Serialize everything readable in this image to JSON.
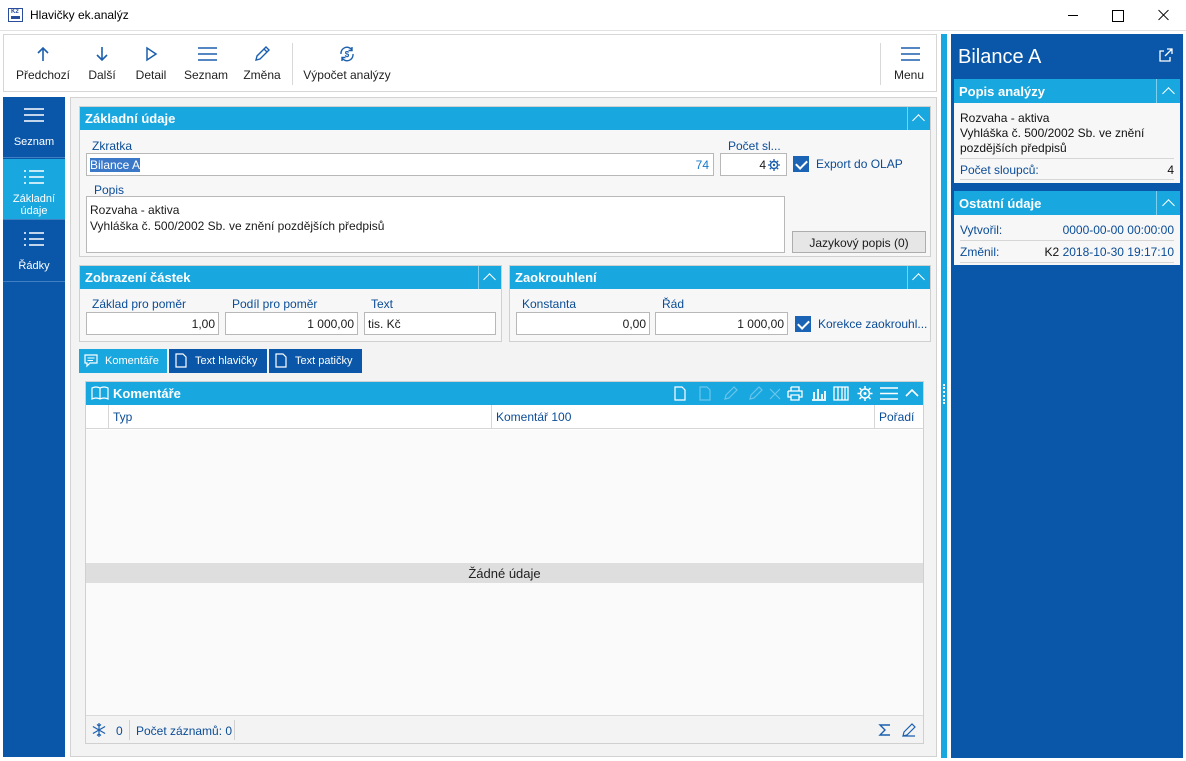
{
  "window": {
    "title": "Hlavičky ek.analýz"
  },
  "toolbar": {
    "prev": "Předchozí",
    "next": "Další",
    "detail": "Detail",
    "list": "Seznam",
    "edit": "Změna",
    "compute": "Výpočet analýzy",
    "menu": "Menu"
  },
  "nav": {
    "list": "Seznam",
    "basic_line1": "Základní",
    "basic_line2": "údaje",
    "rows": "Řádky"
  },
  "basic": {
    "header": "Základní údaje",
    "abbrev_label": "Zkratka",
    "abbrev_value": "Bilance A",
    "abbrev_hint": "74",
    "cols_label": "Počet sl...",
    "cols_value": "4",
    "olap_label": "Export do OLAP",
    "desc_label": "Popis",
    "desc_line1": "Rozvaha - aktiva",
    "desc_line2": "Vyhláška č. 500/2002 Sb. ve znění pozdějších předpisů",
    "lang_button": "Jazykový popis (0)"
  },
  "amounts": {
    "header": "Zobrazení částek",
    "base_label": "Základ pro poměr",
    "base_value": "1,00",
    "share_label": "Podíl pro poměr",
    "share_value": "1 000,00",
    "text_label": "Text",
    "text_value": "tis. Kč"
  },
  "rounding": {
    "header": "Zaokrouhlení",
    "const_label": "Konstanta",
    "const_value": "0,00",
    "order_label": "Řád",
    "order_value": "1 000,00",
    "corr_label": "Korekce zaokrouhl..."
  },
  "tabs": {
    "comments": "Komentáře",
    "header_text": "Text hlavičky",
    "footer_text": "Text patičky"
  },
  "grid": {
    "title": "Komentáře",
    "col_type": "Typ",
    "col_comment": "Komentář 100",
    "col_order": "Pořadí",
    "empty": "Žádné údaje",
    "count": "0",
    "records": "Počet záznamů: 0"
  },
  "right": {
    "title": "Bilance A",
    "desc_header": "Popis analýzy",
    "desc_line1": "Rozvaha - aktiva",
    "desc_line2": "Vyhláška č. 500/2002 Sb. ve znění",
    "desc_line3": "pozdějších předpisů",
    "cols_label": "Počet sloupců:",
    "cols_value": "4",
    "other_header": "Ostatní údaje",
    "created_label": "Vytvořil:",
    "created_value": "0000-00-00 00:00:00",
    "changed_label": "Změnil:",
    "changed_who": "K2",
    "changed_value": "2018-10-30 19:17:10"
  },
  "colors": {
    "accent": "#19a7df",
    "nav": "#0a56a8",
    "label": "#0a4c96"
  }
}
